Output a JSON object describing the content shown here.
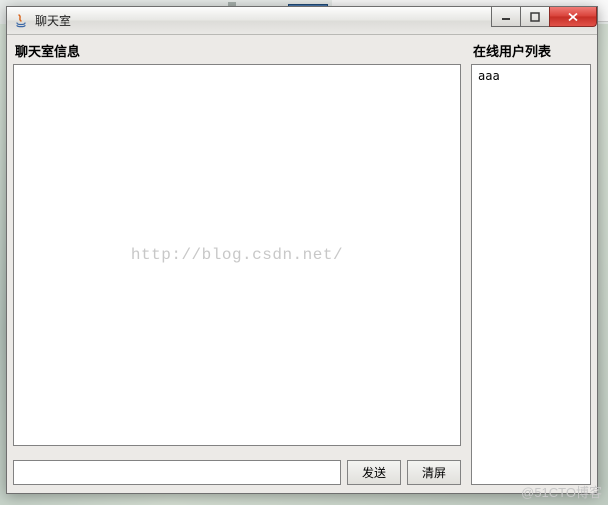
{
  "window": {
    "title": "聊天室"
  },
  "left": {
    "header": "聊天室信息",
    "messages": ""
  },
  "right": {
    "header": "在线用户列表",
    "users": [
      "aaa"
    ]
  },
  "input": {
    "value": "",
    "send_label": "发送",
    "clear_label": "清屏"
  },
  "watermarks": {
    "center": "http://blog.csdn.net/",
    "corner": "@51CTO博客"
  }
}
